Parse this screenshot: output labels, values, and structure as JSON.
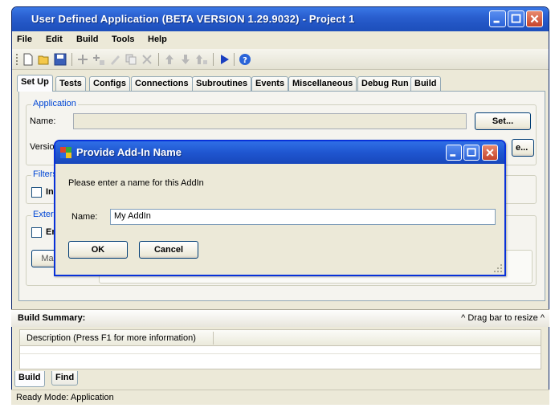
{
  "window": {
    "title": "User Defined Application (BETA VERSION 1.29.9032) - Project 1",
    "title_color": "#2a5fcf"
  },
  "menu": [
    "File",
    "Edit",
    "Build",
    "Tools",
    "Help"
  ],
  "toolbar_icons": [
    "new-icon",
    "open-icon",
    "save-icon",
    "add-icon",
    "add-multiple-icon",
    "edit-icon",
    "copy-icon",
    "delete-icon",
    "move-up-icon",
    "move-down-icon",
    "sort-icon",
    "run-icon",
    "help-icon"
  ],
  "tabs": [
    "Set Up",
    "Tests",
    "Configs",
    "Connections",
    "Subroutines",
    "Events",
    "Miscellaneous",
    "Debug Run",
    "Build"
  ],
  "setup": {
    "application_group": "Application",
    "name_label": "Name:",
    "set_button": "Set...",
    "version_label": "Versio",
    "browse_button": "e...",
    "filters_group": "Filters",
    "filters_checkbox_label": "In",
    "external_group": "Extern",
    "external_checkbox_label": "Er",
    "external_button_label": "Ma"
  },
  "dialog": {
    "title": "Provide Add-In Name",
    "prompt": "Please enter a name for this AddIn",
    "name_label": "Name:",
    "name_value": "My AddIn",
    "ok_label": "OK",
    "cancel_label": "Cancel"
  },
  "build_summary": {
    "title": "Build Summary:",
    "resize_hint": "^ Drag bar to resize ^",
    "column_header": "Description  (Press F1 for more information)"
  },
  "bottom_tabs": [
    "Build",
    "Find"
  ],
  "status": "Ready  Mode: Application"
}
